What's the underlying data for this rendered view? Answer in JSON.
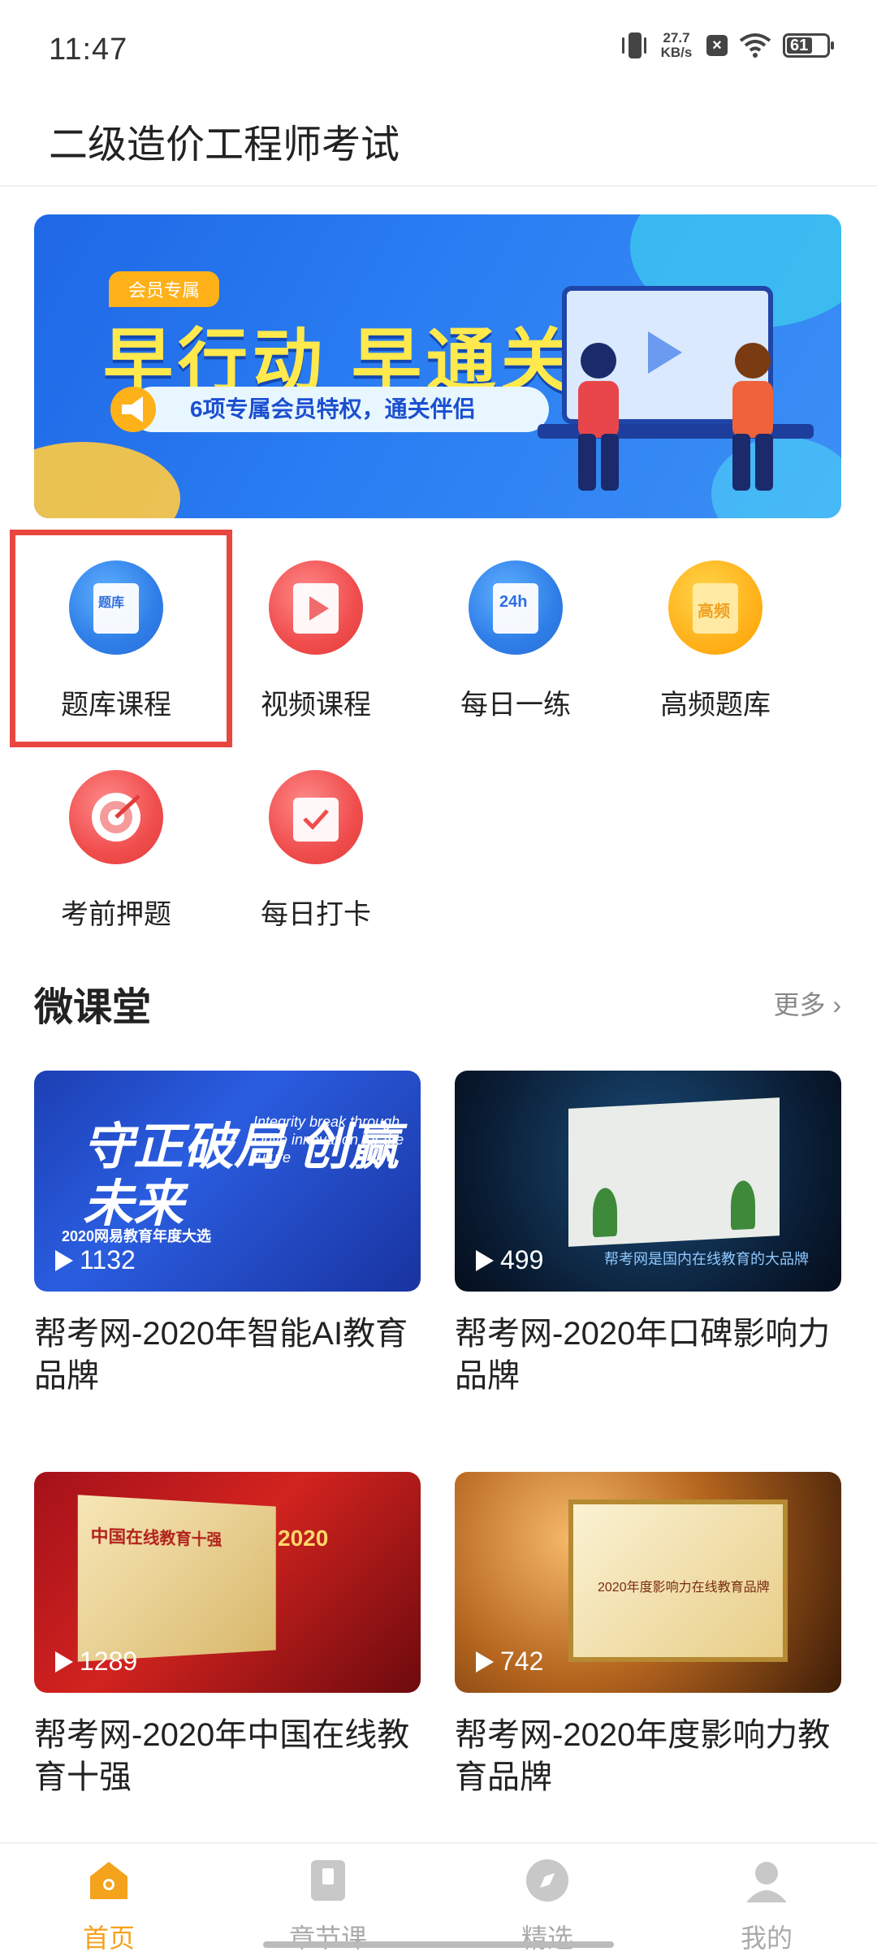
{
  "status_bar": {
    "time": "11:47",
    "net_speed_value": "27.7",
    "net_speed_unit": "KB/s",
    "battery": "61"
  },
  "header": {
    "title": "二级造价工程师考试"
  },
  "banner": {
    "tag": "会员专属",
    "title": "早行动 早通关",
    "subtitle": "6项专属会员特权，通关伴侣"
  },
  "grid": {
    "items": [
      {
        "label": "题库课程",
        "icon": "question-bank-icon",
        "color": "#2f7ee8",
        "glyph": "题库"
      },
      {
        "label": "视频课程",
        "icon": "video-icon",
        "color": "#f04d4d"
      },
      {
        "label": "每日一练",
        "icon": "daily-practice-icon",
        "color": "#2f7ee8",
        "glyph": "24h"
      },
      {
        "label": "高频题库",
        "icon": "high-frequency-icon",
        "color": "#ffb21c",
        "glyph": "高频"
      },
      {
        "label": "考前押题",
        "icon": "target-icon",
        "color": "#f04d4d"
      },
      {
        "label": "每日打卡",
        "icon": "calendar-check-icon",
        "color": "#f04d4d"
      }
    ]
  },
  "section": {
    "title": "微课堂",
    "more": "更多"
  },
  "videos": [
    {
      "title": "帮考网-2020年智能AI教育品牌",
      "plays": "1132",
      "thumb_text": "守正破局 创赢未来",
      "thumb_en": "Integrity break through Drive innovation for the future",
      "thumb_sub": "2020网易教育年度大选"
    },
    {
      "title": "帮考网-2020年口碑影响力品牌",
      "plays": "499",
      "thumb_caption": "帮考网是国内在线教育的大品牌"
    },
    {
      "title": "帮考网-2020年中国在线教育十强",
      "plays": "1289",
      "thumb_text": "中国在线教育十强",
      "thumb_badge": "2020"
    },
    {
      "title": "帮考网-2020年度影响力教育品牌",
      "plays": "742",
      "thumb_text": "2020年度影响力在线教育品牌"
    }
  ],
  "bottom_nav": {
    "items": [
      {
        "label": "首页",
        "icon": "home-icon",
        "active": true
      },
      {
        "label": "章节课",
        "icon": "book-icon",
        "active": false
      },
      {
        "label": "精选",
        "icon": "compass-icon",
        "active": false
      },
      {
        "label": "我的",
        "icon": "profile-icon",
        "active": false
      }
    ]
  },
  "colors": {
    "accent": "#f5a21c",
    "highlight_border": "#e8463f"
  }
}
